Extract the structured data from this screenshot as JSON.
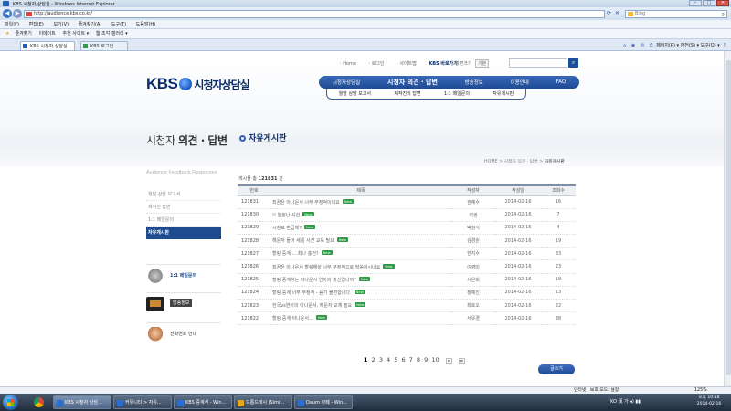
{
  "browser": {
    "title": "KBS 시청자 상담실 - Windows Internet Explorer",
    "url": "http://audience.kbs.co.kr/",
    "search_placeholder": "Bing",
    "menu": [
      "파일(F)",
      "편집(E)",
      "보기(V)",
      "즐겨찾기(A)",
      "도구(T)",
      "도움말(H)"
    ],
    "favorites_bar": [
      "즐겨찾기",
      "이메이트",
      "추천 사이트 ▾",
      "웹 조각 갤러리 ▾"
    ],
    "tabs": [
      "KBS 시청자 상담실",
      "KBS 로그인"
    ],
    "tab_tools": [
      "페이지(P) ▾",
      "안전(S) ▾",
      "도구(O) ▾"
    ],
    "status_zone": "인터넷 | 보호 모드: 설정",
    "zoom": "125%"
  },
  "site": {
    "logo_kbs": "KBS",
    "logo_text": "시청자상담실",
    "util_links": [
      "Home",
      "로그인",
      "사이트맵"
    ],
    "kbs_go": "KBS 바로가기",
    "font_size_label": "화면크기",
    "font_size_value": "기본",
    "gnb": [
      "시청자상담실",
      "시청자 의견 · 답변",
      "방송정보",
      "이용안내",
      "FAQ"
    ],
    "lnb": [
      "월말 상담 보고서",
      "제작진의 답변",
      "1:1 메일문의",
      "자유게시판"
    ]
  },
  "sidebar": {
    "title_normal": "시청자 ",
    "title_bold": "의견 · 답변",
    "subtitle": "Audience Feedback Responses",
    "items": [
      "월말 상담 보고서",
      "제작진 답변",
      "1:1 메일문의",
      "자유게시판"
    ],
    "promos": [
      "1:1 메일문의",
      "방송정보",
      "전화번호 안내"
    ]
  },
  "board": {
    "title": "자유게시판",
    "breadcrumb": [
      "HOME",
      "시청자 의견 · 답변",
      "자유게시판"
    ],
    "total_label": "게시물 총",
    "total_count": "121831",
    "total_unit": "건",
    "columns": [
      "번호",
      "제목",
      "작성자",
      "작성일",
      "조회수"
    ],
    "new_badge": "New",
    "rows": [
      {
        "no": "121831",
        "subject": "최끔은 아나운서 너무 부정적이네요",
        "author": "권혜수",
        "date": "2014-02-16",
        "views": "16"
      },
      {
        "no": "121830",
        "subject": "!! 열정난 사건",
        "author": "최권",
        "date": "2014-02-16",
        "views": "7"
      },
      {
        "no": "121829",
        "subject": "시청료 환급해?",
        "author": "박정식",
        "date": "2014-02-16",
        "views": "4"
      },
      {
        "no": "121828",
        "subject": "해운자 들어 새롭 사건 교육 필요",
        "author": "김경원",
        "date": "2014-02-16",
        "views": "19"
      },
      {
        "no": "121827",
        "subject": "할링 중계.....최나 충전?",
        "author": "한지수",
        "date": "2014-02-16",
        "views": "33"
      },
      {
        "no": "121826",
        "subject": "최끔은 아나운서 할링해설 너무 부정적으로 말씀하시네요",
        "author": "이영미",
        "date": "2014-02-16",
        "views": "23"
      },
      {
        "no": "121825",
        "subject": "할링 중계하는 아나운서 연아의 출신입니까?",
        "author": "서은희",
        "date": "2014-02-16",
        "views": "18"
      },
      {
        "no": "121824",
        "subject": "할링 중계 너무 부정적 - 듣기 불편합니다.",
        "author": "정예진",
        "date": "2014-02-16",
        "views": "13"
      },
      {
        "no": "121823",
        "subject": "한국vs연아의 아나운서, 해운자 교체 필요",
        "author": "최호오",
        "date": "2014-02-16",
        "views": "22"
      },
      {
        "no": "121822",
        "subject": "할링 중계 아나운서...",
        "author": "서유경",
        "date": "2014-02-16",
        "views": "38"
      }
    ],
    "pages": [
      "1",
      "2",
      "3",
      "4",
      "5",
      "6",
      "7",
      "8",
      "9",
      "10"
    ],
    "next_label": "▸",
    "last_label": "▸▸",
    "write_label": "글쓰기"
  },
  "taskbar": {
    "tasks": [
      "KBS 시청자 상담...",
      "커뮤니티 > 자유...",
      "KBS 중계석 - Win...",
      "드롭드캐시 (Simi...",
      "Daum 카페 - Win..."
    ],
    "tray_lang": "KO",
    "tray_ime": "漢 가",
    "clock_time": "오후 10:18",
    "clock_date": "2014-02-16"
  }
}
